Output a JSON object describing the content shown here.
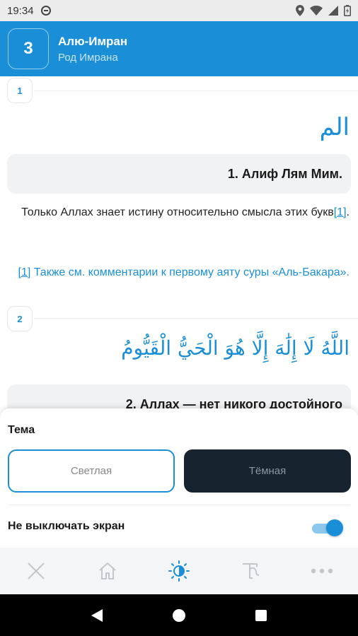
{
  "status_bar": {
    "time": "19:34"
  },
  "header": {
    "surah_number": "3",
    "title": "Алю-Имран",
    "subtitle": "Род Имрана"
  },
  "ayahs": [
    {
      "number": "1",
      "arabic": "الم",
      "translation": "1. Алиф Лям Мим.",
      "commentary_text": "Только Аллах знает истину относительно смысла этих букв",
      "commentary_ref": "[1]",
      "commentary_end": ".",
      "footnote_ref": "[1]",
      "footnote_text": " Также см. комментарии к первому аяту суры «Аль-Бакара»."
    },
    {
      "number": "2",
      "arabic": "اللَّهُ لَا إِلَٰهَ إِلَّا هُوَ الْحَيُّ الْقَيُّومُ",
      "translation": "2. Аллах — нет никого достойного"
    }
  ],
  "settings_sheet": {
    "theme_label": "Тема",
    "theme_light": "Светлая",
    "theme_dark": "Тёмная",
    "selected_theme": "Светлая",
    "keep_screen_label": "Не выключать экран",
    "keep_screen_on": true
  },
  "bottom_nav": [
    "close-icon",
    "home-icon",
    "brightness-icon",
    "text-style-icon",
    "more-icon"
  ],
  "colors": {
    "accent": "#1a8fd8",
    "dark_theme_bg": "#17232f",
    "card_bg": "#f1f2f3"
  }
}
